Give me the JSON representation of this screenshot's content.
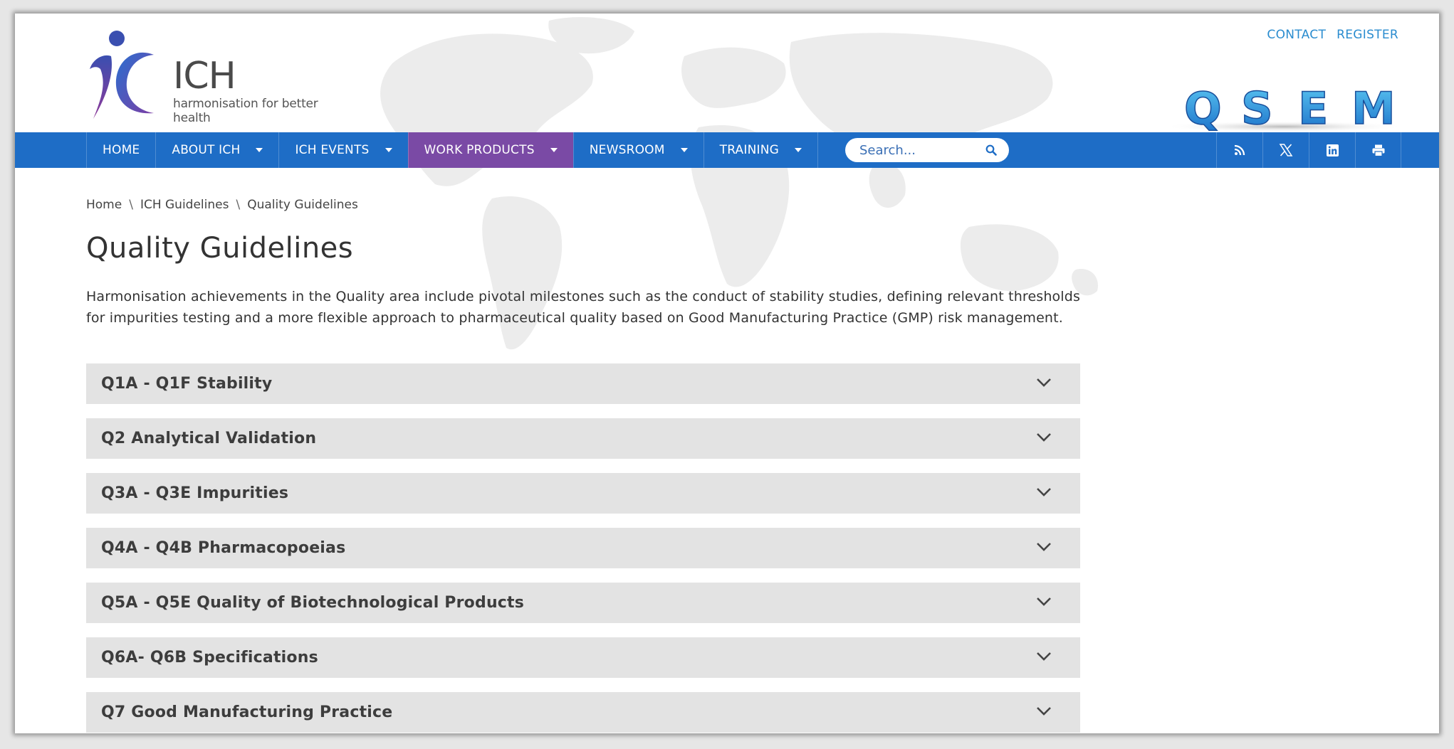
{
  "header": {
    "logo_wordmark": "ICH",
    "logo_tagline": "harmonisation for better health",
    "top_links": [
      "CONTACT",
      "REGISTER"
    ],
    "qsem_letters": [
      "Q",
      "S",
      "E",
      "M"
    ]
  },
  "nav": {
    "items": [
      {
        "label": "HOME",
        "dropdown": false,
        "active": false
      },
      {
        "label": "ABOUT ICH",
        "dropdown": true,
        "active": false
      },
      {
        "label": "ICH EVENTS",
        "dropdown": true,
        "active": false
      },
      {
        "label": "WORK PRODUCTS",
        "dropdown": true,
        "active": true
      },
      {
        "label": "NEWSROOM",
        "dropdown": true,
        "active": false
      },
      {
        "label": "TRAINING",
        "dropdown": true,
        "active": false
      }
    ],
    "search_placeholder": "Search...",
    "social_icons": [
      "rss-icon",
      "x-icon",
      "linkedin-icon",
      "print-icon"
    ],
    "colors": {
      "bar": "#1e6dc6",
      "active": "#7a4aa5"
    }
  },
  "breadcrumb": [
    "Home",
    "ICH Guidelines",
    "Quality Guidelines"
  ],
  "page": {
    "title": "Quality Guidelines",
    "intro": "Harmonisation achievements in the Quality area include pivotal milestones such as the conduct of stability studies, defining relevant thresholds for impurities testing and a more flexible approach to pharmaceutical quality based on Good Manufacturing Practice (GMP) risk management."
  },
  "accordion": [
    "Q1A - Q1F Stability",
    "Q2 Analytical Validation",
    "Q3A - Q3E Impurities",
    "Q4A - Q4B Pharmacopoeias",
    "Q5A - Q5E Quality of Biotechnological Products",
    "Q6A- Q6B Specifications",
    "Q7 Good Manufacturing Practice"
  ]
}
